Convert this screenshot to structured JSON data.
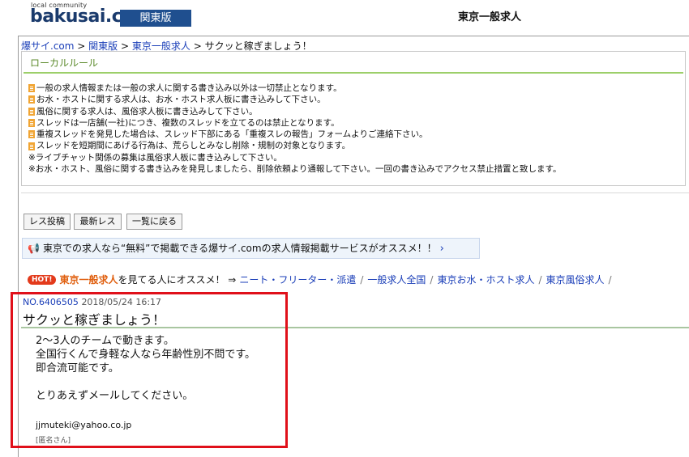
{
  "header": {
    "logo_small": "local community",
    "logo": "bakusai.com",
    "region": "関東版",
    "page_title": "東京一般求人"
  },
  "breadcrumb": {
    "items": [
      "爆サイ.com",
      "関東版",
      "東京一般求人"
    ],
    "separator": ">",
    "current": "サクッと稼ぎましょう！"
  },
  "rules": {
    "title": "ローカルルール",
    "items": [
      {
        "icon": "document-icon",
        "text": "一般の求人情報または一般の求人に関する書き込み以外は一切禁止となります。"
      },
      {
        "icon": "document-icon",
        "text": "お水・ホストに関する求人は、お水・ホスト求人板に書き込みして下さい。"
      },
      {
        "icon": "document-icon",
        "text": "風俗に関する求人は、風俗求人板に書き込みして下さい。"
      },
      {
        "icon": "document-icon",
        "text": "スレッドは一店舗(一社)につき、複数のスレッドを立てるのは禁止となります。"
      },
      {
        "icon": "document-icon",
        "text": "重複スレッドを発見した場合は、スレッド下部にある「重複スレの報告」フォームよりご連絡下さい。"
      },
      {
        "icon": "document-icon",
        "text": "スレッドを短期間にあげる行為は、荒らしとみなし削除・規制の対象となります。"
      },
      {
        "icon": "",
        "text": "※ライブチャット関係の募集は風俗求人板に書き込みして下さい。"
      },
      {
        "icon": "",
        "text": "※お水・ホスト、風俗に関する書き込みを発見しましたら、削除依頼より通報して下さい。一回の書き込みでアクセス禁止措置と致します。"
      }
    ]
  },
  "buttons": {
    "post_reply": "レス投稿",
    "latest": "最新レス",
    "back_to_list": "一覧に戻る"
  },
  "promo": {
    "text": "東京での求人なら“無料”で掲載できる爆サイ.comの求人情報掲載サービスがオススメ！！",
    "chevron": "›"
  },
  "hot": {
    "badge": "HOT!",
    "highlight": "東京一般求人",
    "suffix": "を見てる人にオススメ！ ⇒",
    "links": [
      "ニート・フリーター・派遣",
      "一般求人全国",
      "東京お水・ホスト求人",
      "東京風俗求人"
    ],
    "trailing": "/"
  },
  "post": {
    "number": "NO.6406505",
    "date": "2018/05/24 16:17",
    "title": "サクッと稼ぎましょう！",
    "body": "2〜3人のチームで動きます。\n全国行くんで身軽な人なら年齢性別不問です。\n即合流可能です。\n\nとりあえずメールしてください。",
    "email": "jjmuteki@yahoo.co.jp",
    "author": "[匿名さん]"
  },
  "colors": {
    "brand": "#1a3a6c",
    "region_bg": "#1f4f8f",
    "link": "#1a3eb8",
    "hot": "#e33a1b",
    "highlight_box": "#e0101a"
  }
}
